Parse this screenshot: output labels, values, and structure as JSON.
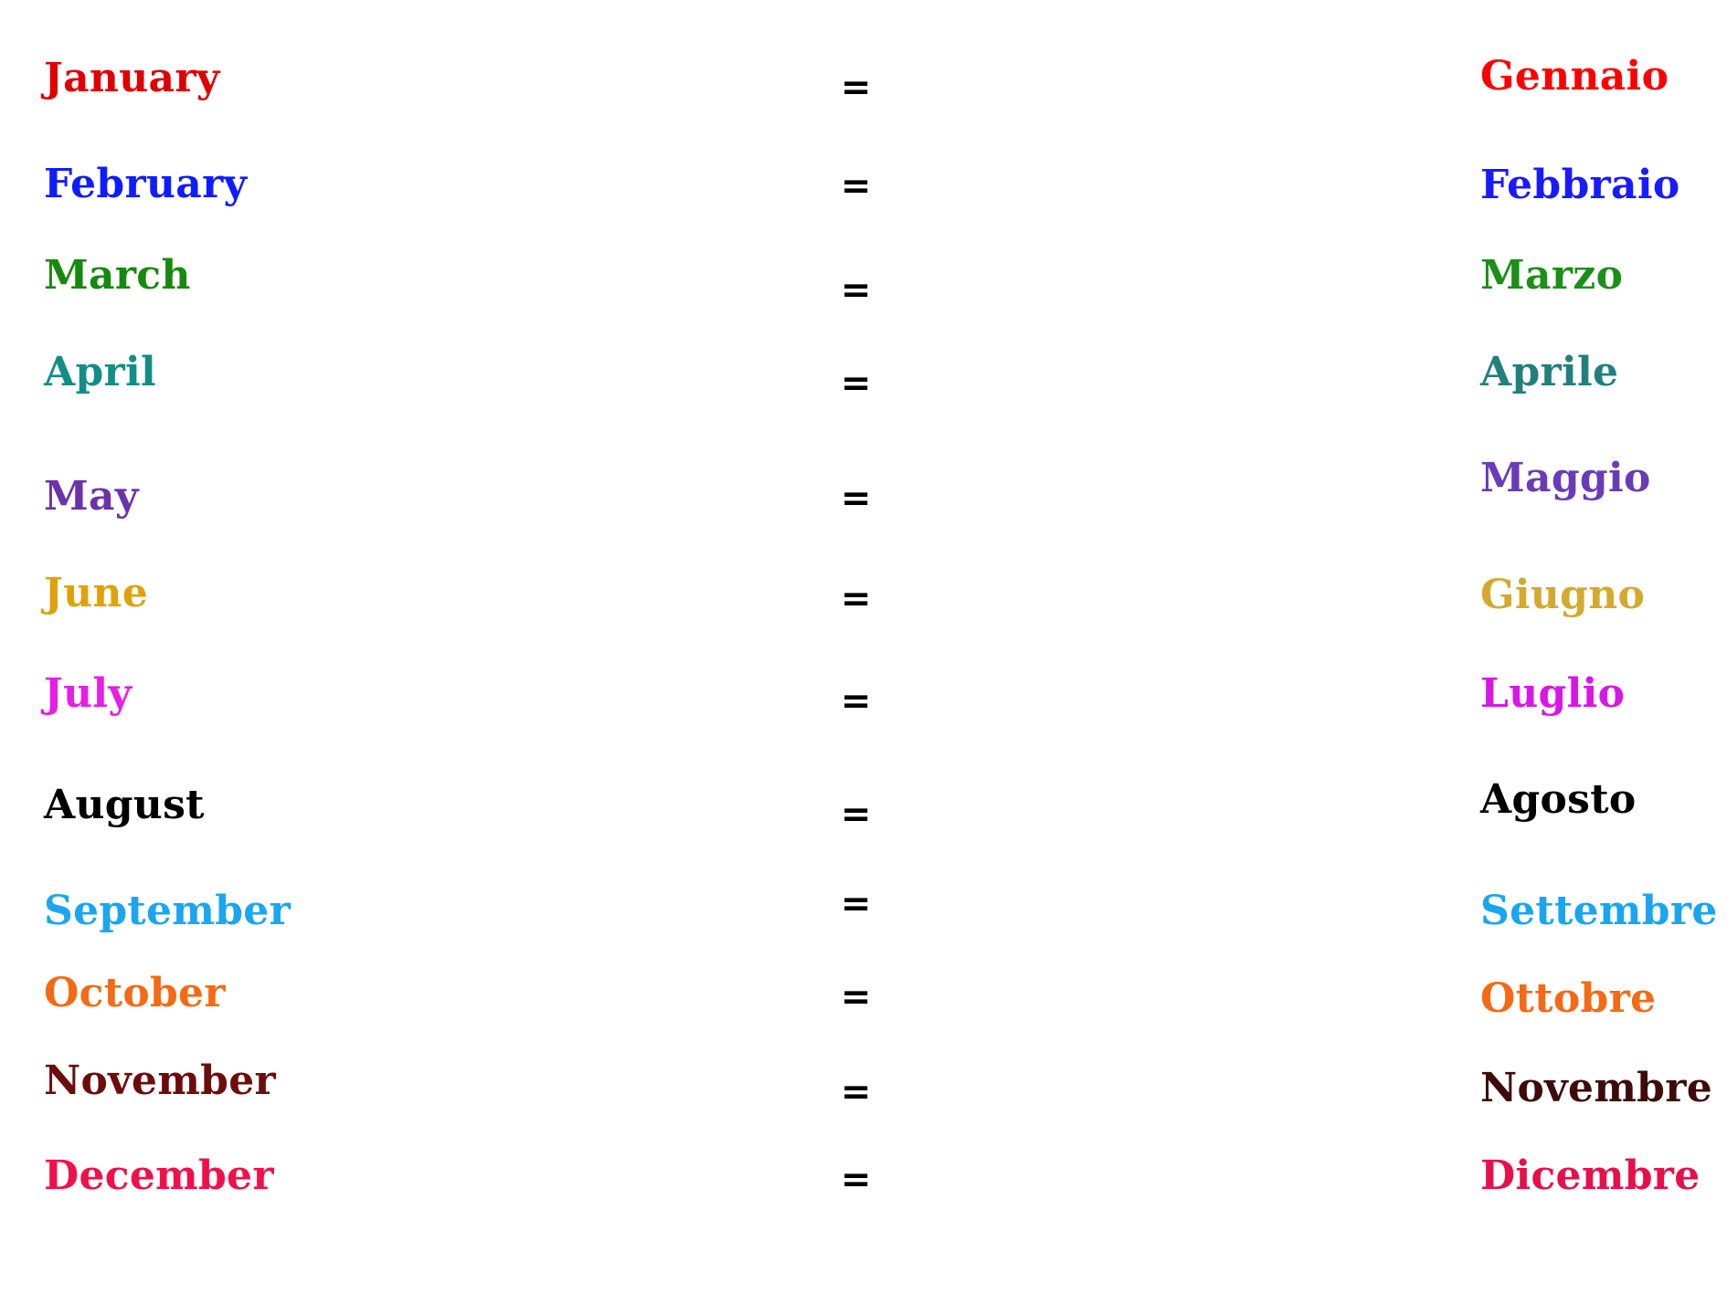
{
  "rows": [
    {
      "english": "January",
      "equals": "=",
      "italian": "Gennaio",
      "color_en": "#e00000",
      "color_it": "#ff0000"
    },
    {
      "english": "February",
      "equals": "=",
      "italian": "Febbraio",
      "color_en": "#0f1cff",
      "color_it": "#1a1aff"
    },
    {
      "english": "March",
      "equals": "=",
      "italian": "Marzo",
      "color_en": "#168a0c",
      "color_it": "#1a9016"
    },
    {
      "english": "April",
      "equals": "=",
      "italian": "Aprile",
      "color_en": "#128e86",
      "color_it": "#21807c"
    },
    {
      "english": "May",
      "equals": "=",
      "italian": "Maggio",
      "color_en": "#6a33ab",
      "color_it": "#6a3bb8"
    },
    {
      "english": "June",
      "equals": "=",
      "italian": "Giugno",
      "color_en": "#e0a20c",
      "color_it": "#d4aa2e"
    },
    {
      "english": "July",
      "equals": "=",
      "italian": "Luglio",
      "color_en": "#e61ee6",
      "color_it": "#d916e6"
    },
    {
      "english": "August",
      "equals": "=",
      "italian": "Agosto",
      "color_en": "#000000",
      "color_it": "#000000"
    },
    {
      "english": "September",
      "equals": "=",
      "italian": "Settembre",
      "color_en": "#1aa6f0",
      "color_it": "#19a6f0"
    },
    {
      "english": "October",
      "equals": "=",
      "italian": "Ottobre",
      "color_en": "#f56a14",
      "color_it": "#f56a14"
    },
    {
      "english": "November",
      "equals": "=",
      "italian": "Novembre",
      "color_en": "#6e0c0c",
      "color_it": "#3e0a0a"
    },
    {
      "english": "December",
      "equals": "=",
      "italian": "Dicembre",
      "color_en": "#f0104a",
      "color_it": "#e6104a"
    }
  ]
}
